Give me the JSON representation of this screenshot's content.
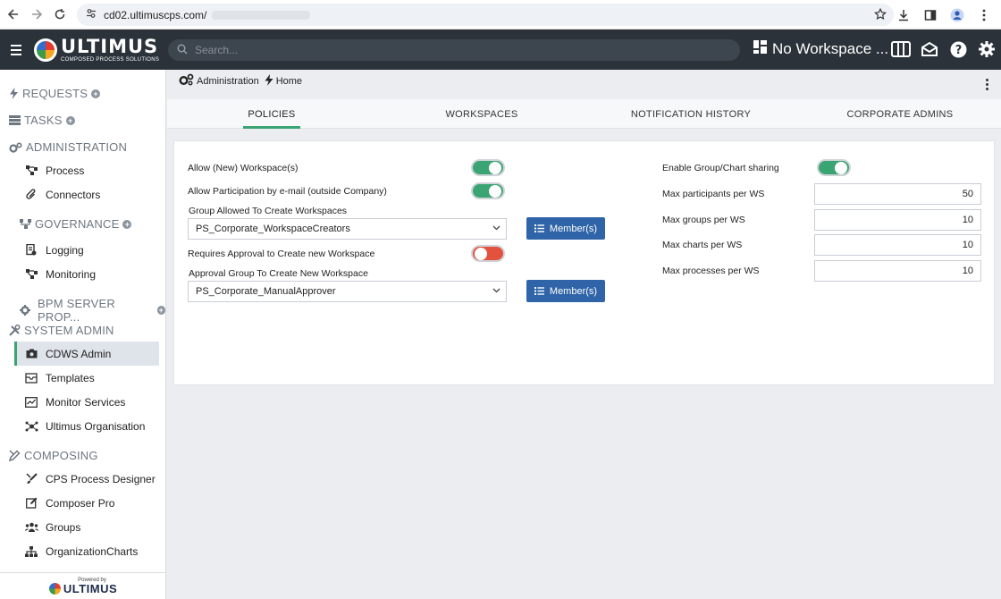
{
  "browser": {
    "url": "cd02.ultimuscps.com/"
  },
  "header": {
    "logo_name": "ULTIMUS",
    "logo_sub": "COMPOSED PROCESS SOLUTIONS",
    "search_placeholder": "Search...",
    "workspace_label": "No Workspace ..."
  },
  "sidebar": {
    "requests": "REQUESTS",
    "tasks": "TASKS",
    "administration": "ADMINISTRATION",
    "admin_items": [
      "Process",
      "Connectors"
    ],
    "governance": "GOVERNANCE",
    "governance_items": [
      "Logging",
      "Monitoring"
    ],
    "bpm": "BPM SERVER PROP...",
    "system_admin": "SYSTEM ADMIN",
    "system_items": [
      "CDWS Admin",
      "Templates",
      "Monitor Services",
      "Ultimus Organisation"
    ],
    "composing": "COMPOSING",
    "composing_items": [
      "CPS Process Designer",
      "Composer Pro",
      "Groups",
      "OrganizationCharts"
    ],
    "powered_by": "Powered by",
    "footer_logo": "ULTIMUS"
  },
  "breadcrumb": {
    "admin": "Administration",
    "home": "Home"
  },
  "tabs": [
    "POLICIES",
    "WORKSPACES",
    "NOTIFICATION HISTORY",
    "CORPORATE ADMINS"
  ],
  "policies": {
    "allow_new_ws": "Allow (New) Workspace(s)",
    "allow_participation": "Allow Participation by e-mail (outside Company)",
    "group_allowed_label": "Group Allowed To Create Workspaces",
    "group_allowed_value": "PS_Corporate_WorkspaceCreators",
    "requires_approval": "Requires Approval to Create new Workspace",
    "approval_group_label": "Approval Group To Create New Workspace",
    "approval_group_value": "PS_Corporate_ManualApprover",
    "member_button": "Member(s)",
    "enable_sharing": "Enable Group/Chart sharing",
    "max_participants_label": "Max participants per WS",
    "max_participants": "50",
    "max_groups_label": "Max groups per WS",
    "max_groups": "10",
    "max_charts_label": "Max charts per WS",
    "max_charts": "10",
    "max_processes_label": "Max processes per WS",
    "max_processes": "10"
  },
  "toggles": {
    "allow_new_ws": true,
    "allow_participation": true,
    "requires_approval": false,
    "enable_sharing": true
  },
  "colors": {
    "accent_green": "#3aa572",
    "toggle_off_red": "#e3513f",
    "button_blue": "#2f64a8",
    "header_dark": "#2b323a"
  }
}
